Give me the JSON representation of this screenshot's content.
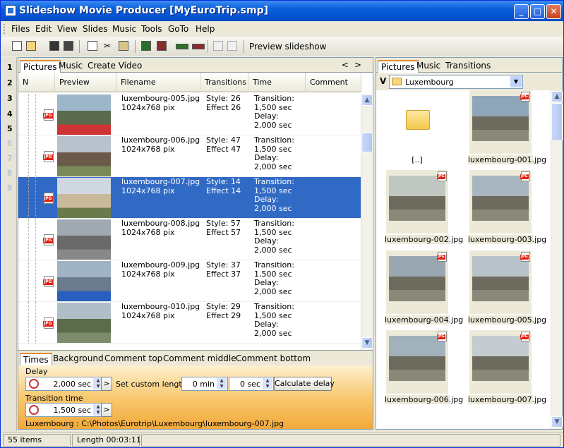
{
  "window": {
    "title": "Slideshow Movie Producer [MyEuroTrip.smp]",
    "controls": {
      "minimize": "_",
      "maximize": "□",
      "close": "✕"
    }
  },
  "menu": [
    "Files",
    "Edit",
    "View",
    "Slides",
    "Music",
    "Tools",
    "GoTo",
    "Help"
  ],
  "toolbar": {
    "preview_label": "Preview slideshow"
  },
  "row_numbers": [
    "1",
    "2",
    "3",
    "4",
    "5",
    "6",
    "7",
    "8",
    "9"
  ],
  "left_panel": {
    "tabs": [
      "Pictures",
      "Music",
      "Create Video"
    ],
    "nav": {
      "prev": "<",
      "next": ">"
    },
    "columns": [
      "N",
      "Preview",
      "Filename",
      "Transitions",
      "Time",
      "Comment"
    ],
    "rows": [
      {
        "filename": "luxembourg-005.jpg",
        "size": "1024x768 pix",
        "style": "Style: 26",
        "effect": "Effect 26",
        "time": "Transition:\n1,500 sec\nDelay:\n2,000 sec",
        "selected": false
      },
      {
        "filename": "luxembourg-006.jpg",
        "size": "1024x768 pix",
        "style": "Style: 47",
        "effect": "Effect 47",
        "time": "Transition:\n1,500 sec\nDelay:\n2,000 sec",
        "selected": false
      },
      {
        "filename": "luxembourg-007.jpg",
        "size": "1024x768 pix",
        "style": "Style: 14",
        "effect": "Effect 14",
        "time": "Transition:\n1,500 sec\nDelay:\n2,000 sec",
        "selected": true
      },
      {
        "filename": "luxembourg-008.jpg",
        "size": "1024x768 pix",
        "style": "Style: 57",
        "effect": "Effect 57",
        "time": "Transition:\n1,500 sec\nDelay:\n2,000 sec",
        "selected": false
      },
      {
        "filename": "luxembourg-009.jpg",
        "size": "1024x768 pix",
        "style": "Style: 37",
        "effect": "Effect 37",
        "time": "Transition:\n1,500 sec\nDelay:\n2,000 sec",
        "selected": false
      },
      {
        "filename": "luxembourg-010.jpg",
        "size": "1024x768 pix",
        "style": "Style: 29",
        "effect": "Effect 29",
        "time": "Transition:\n1,500 sec\nDelay:\n2,000 sec",
        "selected": false
      }
    ],
    "jpg_badge": "JPG"
  },
  "bottom_panel": {
    "tabs": [
      "Times",
      "Background",
      "Comment top",
      "Comment middle",
      "Comment bottom"
    ],
    "delay_label": "Delay",
    "delay_value": "2,000 sec",
    "custom_length_label": "Set custom length:",
    "custom_min": "0 min",
    "custom_sec": "0 sec",
    "calculate_label": "Calculate delay",
    "transition_label": "Transition time",
    "transition_value": "1,500 sec",
    "path": "Luxembourg : C:\\Photos\\Eurotrip\\Luxembourg\\luxembourg-007.jpg",
    "arrow": ">"
  },
  "right_panel": {
    "tabs": [
      "Pictures",
      "Music",
      "Transitions"
    ],
    "drive": "V",
    "folder": "Luxembourg",
    "up_label": "[..]",
    "items": [
      "luxembourg-001.jpg",
      "luxembourg-002.jpg",
      "luxembourg-003.jpg",
      "luxembourg-004.jpg",
      "luxembourg-005.jpg",
      "luxembourg-006.jpg",
      "luxembourg-007.jpg"
    ]
  },
  "status": {
    "items": "55 items",
    "length": "Length 00:03:11"
  }
}
